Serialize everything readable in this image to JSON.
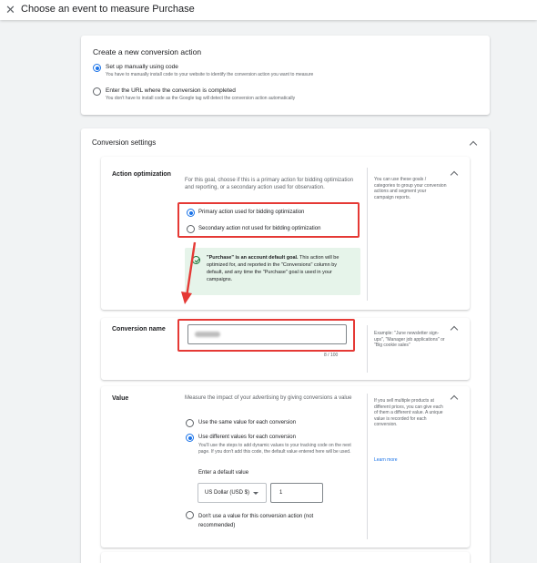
{
  "header": {
    "close_icon": "close-icon",
    "title": "Choose an event to measure Purchase"
  },
  "create": {
    "title": "Create a new conversion action",
    "options": [
      {
        "label": "Set up manually using code",
        "sub": "You have to manually install code to your website to identify the conversion action you want to measure",
        "selected": true
      },
      {
        "label": "Enter the URL where the conversion is completed",
        "sub": "You don't have to install code as the Google tag will detect the conversion action automatically",
        "selected": false
      }
    ]
  },
  "settings": {
    "title": "Conversion settings",
    "action_optimization": {
      "label": "Action optimization",
      "desc": "For this goal, choose if this is a primary action for bidding optimization and reporting, or a secondary action used for observation.",
      "options": [
        {
          "label": "Primary action used for bidding optimization",
          "selected": true
        },
        {
          "label": "Secondary action not used for bidding optimization",
          "selected": false
        }
      ],
      "notice_bold": "\"Purchase\" is an account default goal.",
      "notice_rest": " This action will be optimized for, and reported in the \"Conversions\" column by default, and any time the \"Purchase\" goal is used in your campaigns.",
      "help": "You can use these goals / categories to group your conversion actions and segment your campaign reports."
    },
    "conversion_name": {
      "label": "Conversion name",
      "counter": "8 / 100",
      "help": "Example: \"June newsletter sign-ups\", \"Manager job applications\" or \"Big cookie sales\""
    },
    "value": {
      "label": "Value",
      "desc": "Measure the impact of your advertising by giving conversions a value",
      "options": [
        {
          "label": "Use the same value for each conversion",
          "selected": false
        },
        {
          "label": "Use different values for each conversion",
          "selected": true
        },
        {
          "label": "Don't use a value for this conversion action (not recommended)",
          "selected": false
        }
      ],
      "different_sub": "You'll use the steps to add dynamic values to your tracking code on the next page. If you don't add this code, the default value entered here will be used.",
      "default_label": "Enter a default value",
      "currency": "US Dollar (USD $)",
      "default_value": "1",
      "help": "If you sell multiple products at different prices, you can give each of them a different value. A unique value is recorded for each conversion.",
      "learn_more": "Learn more"
    }
  },
  "colors": {
    "accent": "#1a73e8",
    "highlight": "#e53935",
    "success_bg": "#e6f4ea",
    "success": "#137333"
  }
}
